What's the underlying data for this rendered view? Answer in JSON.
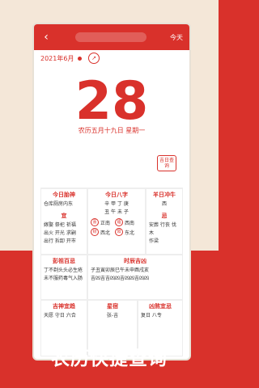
{
  "titlebar": {
    "today_label": "今天"
  },
  "date_row": {
    "date_label": "2021年6月",
    "nav_icon": "circle-arrow-icon"
  },
  "main_day": {
    "day": "28",
    "lunar": "农历五月十九日  星期一"
  },
  "badge": {
    "label": "吉日查询"
  },
  "panels": {
    "left": {
      "title": "今日胎神",
      "line1": "仓库厕房内东",
      "title2": "宜",
      "lines2": [
        "嫁娶 祭祀 祈福",
        "出火 开光 求嗣",
        "出行 拆卸 开市"
      ]
    },
    "middle": {
      "title": "今日八字",
      "line1": "辛 甲 丁 庚",
      "line2": "丑 午 未 子",
      "directions": [
        "正南",
        "西南",
        "西北",
        "东北"
      ]
    },
    "right": {
      "title": "羊日冲牛",
      "line1": "西",
      "title2": "忌",
      "lines2": [
        "安葬 行丧 伐木",
        "作梁"
      ]
    },
    "pengzu": {
      "title": "彭祖百忌",
      "lines": [
        "丁不剃头头必生疮",
        "未不服药毒气入肠"
      ]
    },
    "shichen": {
      "title": "时辰吉凶",
      "line1": "子丑寅卯辰巳午未申酉戌亥",
      "line2": "吉凶吉吉凶凶吉凶凶吉凶凶"
    },
    "bottom": [
      {
        "title": "吉神宜趋",
        "text": "天愿 守日 六合"
      },
      {
        "title": "星宿",
        "text": "张-吉"
      },
      {
        "title": "凶煞宜忌",
        "text": "复日 八专"
      }
    ]
  },
  "caption": "农历快捷查询",
  "colors": {
    "accent": "#d9312b",
    "bg_light": "#f4e7d8"
  }
}
